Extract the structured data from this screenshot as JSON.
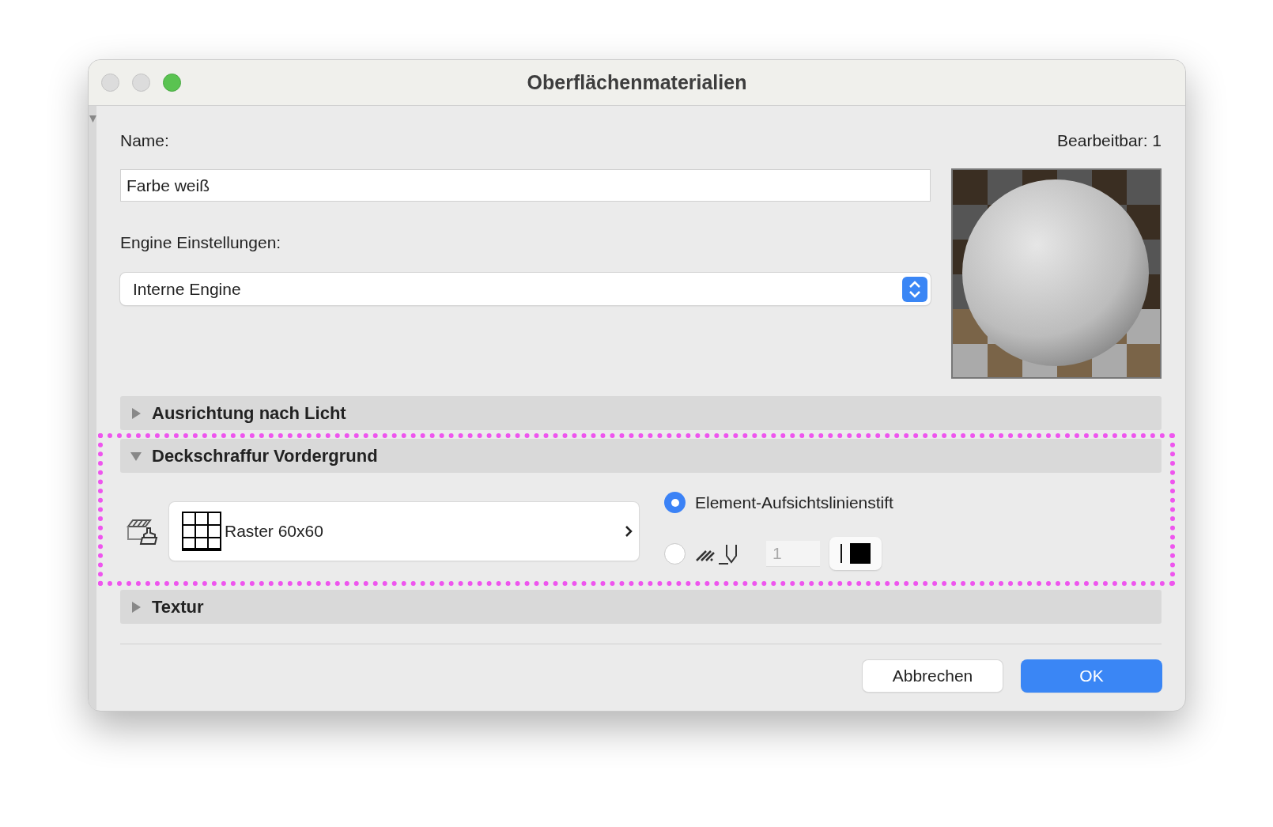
{
  "window": {
    "title": "Oberflächenmaterialien"
  },
  "name": {
    "label": "Name:",
    "value": "Farbe weiß"
  },
  "editable": "Bearbeitbar: 1",
  "engine": {
    "label": "Engine Einstellungen:",
    "value": "Interne Engine"
  },
  "sections": [
    {
      "title": "Ausrichtung nach Licht",
      "expanded": false
    },
    {
      "title": "Deckschraffur Vordergrund",
      "expanded": true,
      "highlighted": true
    },
    {
      "title": "Textur",
      "expanded": false
    }
  ],
  "cover_fill": {
    "fill": "Raster 60x60",
    "options": [
      {
        "kind": "label",
        "label": "Element-Aufsichtslinienstift",
        "selected": true
      },
      {
        "kind": "pen",
        "pen_number": "1",
        "selected": false
      }
    ]
  },
  "buttons": [
    {
      "label": "Abbrechen",
      "primary": false
    },
    {
      "label": "OK",
      "primary": true
    }
  ]
}
